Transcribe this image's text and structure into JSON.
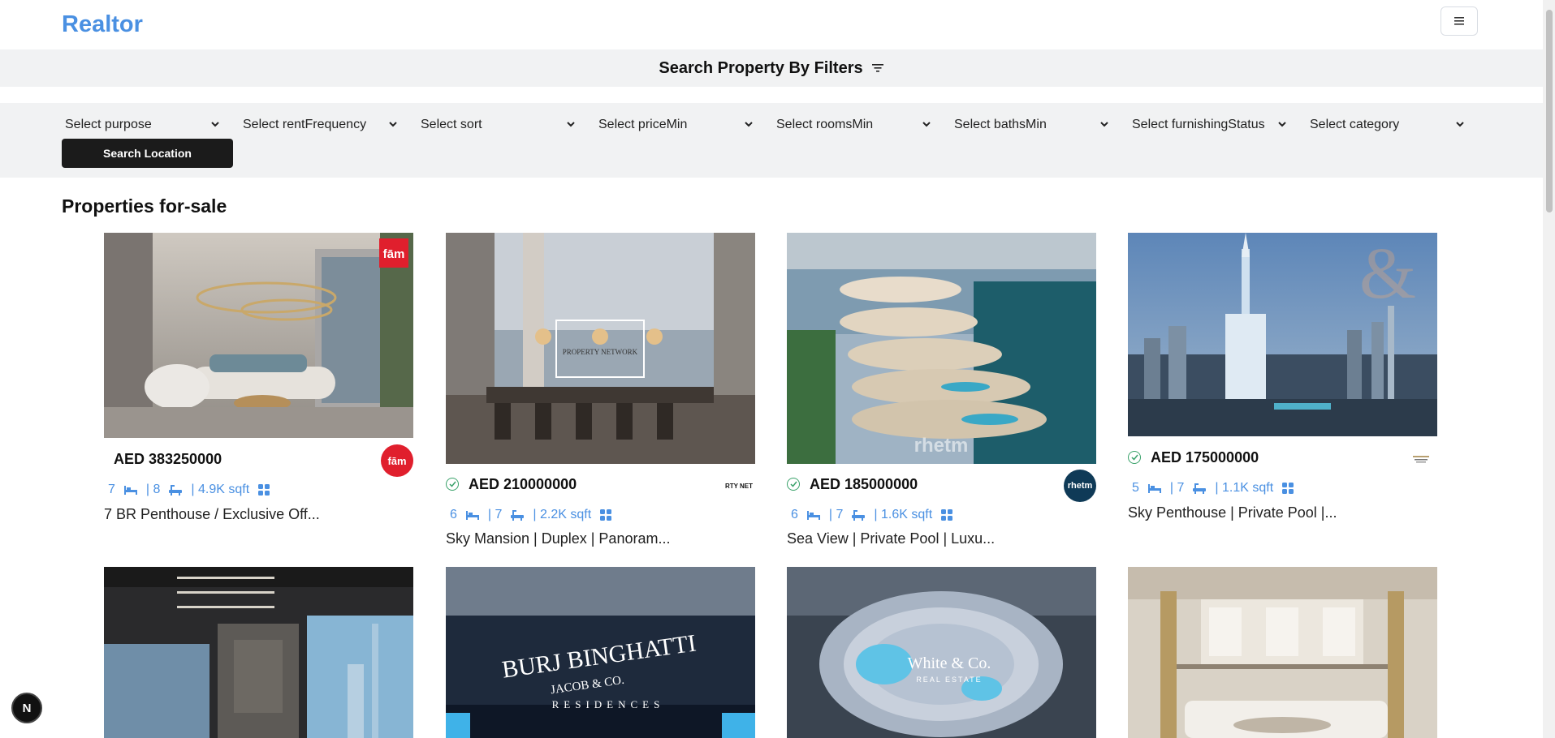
{
  "brand": {
    "name": "Realtor"
  },
  "filters": {
    "title": "Search Property By Filters",
    "selects": [
      {
        "label": "Select purpose"
      },
      {
        "label": "Select rentFrequency"
      },
      {
        "label": "Select sort"
      },
      {
        "label": "Select priceMin"
      },
      {
        "label": "Select roomsMin"
      },
      {
        "label": "Select bathsMin"
      },
      {
        "label": "Select furnishingStatus"
      },
      {
        "label": "Select category"
      }
    ],
    "search_location": "Search Location"
  },
  "section_title": "Properties for-sale",
  "properties": [
    {
      "price": "AED 383250000",
      "rooms": "7",
      "baths": "| 8",
      "area": "| 4.9K sqft",
      "title": "7 BR Penthouse / Exclusive Off...",
      "verified": false,
      "agency": "fām"
    },
    {
      "price": "AED 210000000",
      "rooms": "6",
      "baths": "| 7",
      "area": "| 2.2K sqft",
      "title": "Sky Mansion | Duplex | Panoram...",
      "verified": true,
      "agency": "RTY NET"
    },
    {
      "price": "AED 185000000",
      "rooms": "6",
      "baths": "| 7",
      "area": "| 1.6K sqft",
      "title": "Sea View | Private Pool | Luxu...",
      "verified": true,
      "agency": "rhetm"
    },
    {
      "price": "AED 175000000",
      "rooms": "5",
      "baths": "| 7",
      "area": "| 1.1K sqft",
      "title": "Sky Penthouse | Private Pool |...",
      "verified": true,
      "agency": ""
    }
  ],
  "image_text": {
    "property_network": "PROPERTY NETWORK",
    "burj_binghatti": "BURJ BINGHATTI",
    "jacob_co": "JACOB & CO.",
    "residences": "RESIDENCES",
    "white_co": "White & Co.",
    "real_estate": "REAL ESTATE",
    "rhetm": "rhetm"
  },
  "badge": {
    "letter": "N"
  },
  "colors": {
    "brand": "#4a90e2",
    "verified": "#38a169",
    "dark": "#1b1b1b",
    "filter_bg": "#f1f2f3"
  }
}
